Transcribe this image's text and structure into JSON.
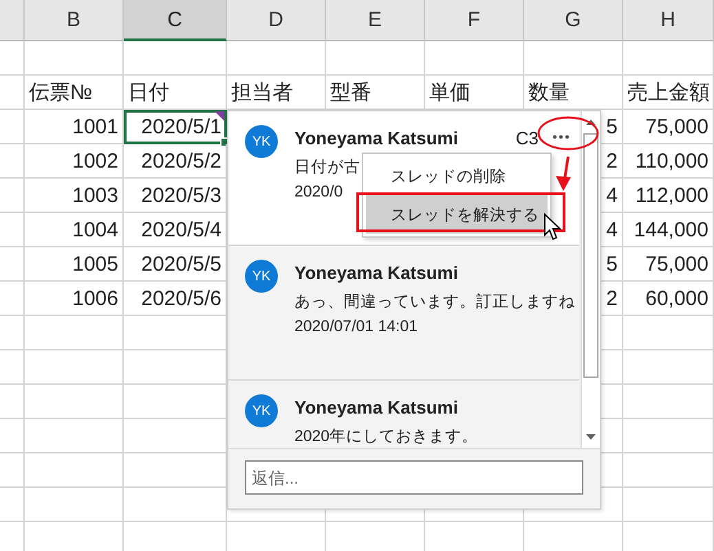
{
  "columns": [
    {
      "label": "B",
      "selected": false
    },
    {
      "label": "C",
      "selected": true
    },
    {
      "label": "D",
      "selected": false
    },
    {
      "label": "E",
      "selected": false
    },
    {
      "label": "F",
      "selected": false
    },
    {
      "label": "G",
      "selected": false
    },
    {
      "label": "H",
      "selected": false
    }
  ],
  "rows": [
    {
      "kind": "header",
      "cells": {
        "B": "伝票№",
        "C": "日付",
        "D": "担当者",
        "E": "型番",
        "F": "単価",
        "G": "数量",
        "H": "売上金額"
      }
    },
    {
      "kind": "data",
      "date_selected": true,
      "date_has_comment": true,
      "cells": {
        "B": "1001",
        "C": "2020/5/1",
        "G": "5",
        "H": "75,000"
      }
    },
    {
      "kind": "data",
      "date_selected": false,
      "date_has_comment": false,
      "cells": {
        "B": "1002",
        "C": "2020/5/2",
        "G": "2",
        "H": "110,000"
      }
    },
    {
      "kind": "data",
      "date_selected": false,
      "date_has_comment": false,
      "cells": {
        "B": "1003",
        "C": "2020/5/3",
        "G": "4",
        "H": "112,000"
      }
    },
    {
      "kind": "data",
      "date_selected": false,
      "date_has_comment": false,
      "cells": {
        "B": "1004",
        "C": "2020/5/4",
        "G": "4",
        "H": "144,000"
      }
    },
    {
      "kind": "data",
      "date_selected": false,
      "date_has_comment": false,
      "cells": {
        "B": "1005",
        "C": "2020/5/5",
        "G": "5",
        "H": "75,000"
      }
    },
    {
      "kind": "data",
      "date_selected": false,
      "date_has_comment": false,
      "cells": {
        "B": "1006",
        "C": "2020/5/6",
        "G": "2",
        "H": "60,000"
      }
    }
  ],
  "comments": [
    {
      "initials": "YK",
      "author": "Yoneyama Katsumi",
      "cell_ref": "C3",
      "more": "•••",
      "text": "日付が古",
      "time": "2020/0",
      "selected": true
    },
    {
      "initials": "YK",
      "author": "Yoneyama Katsumi",
      "text": "あっ、間違っています。訂正しますね",
      "time": "2020/07/01 14:01",
      "selected": false
    },
    {
      "initials": "YK",
      "author": "Yoneyama Katsumi",
      "text": "2020年にしておきます。",
      "selected": false
    }
  ],
  "context_menu": [
    {
      "label": "スレッドの削除",
      "selected": false
    },
    {
      "label": "スレッドを解決する",
      "selected": true
    }
  ],
  "reply": {
    "placeholder": "返信..."
  }
}
